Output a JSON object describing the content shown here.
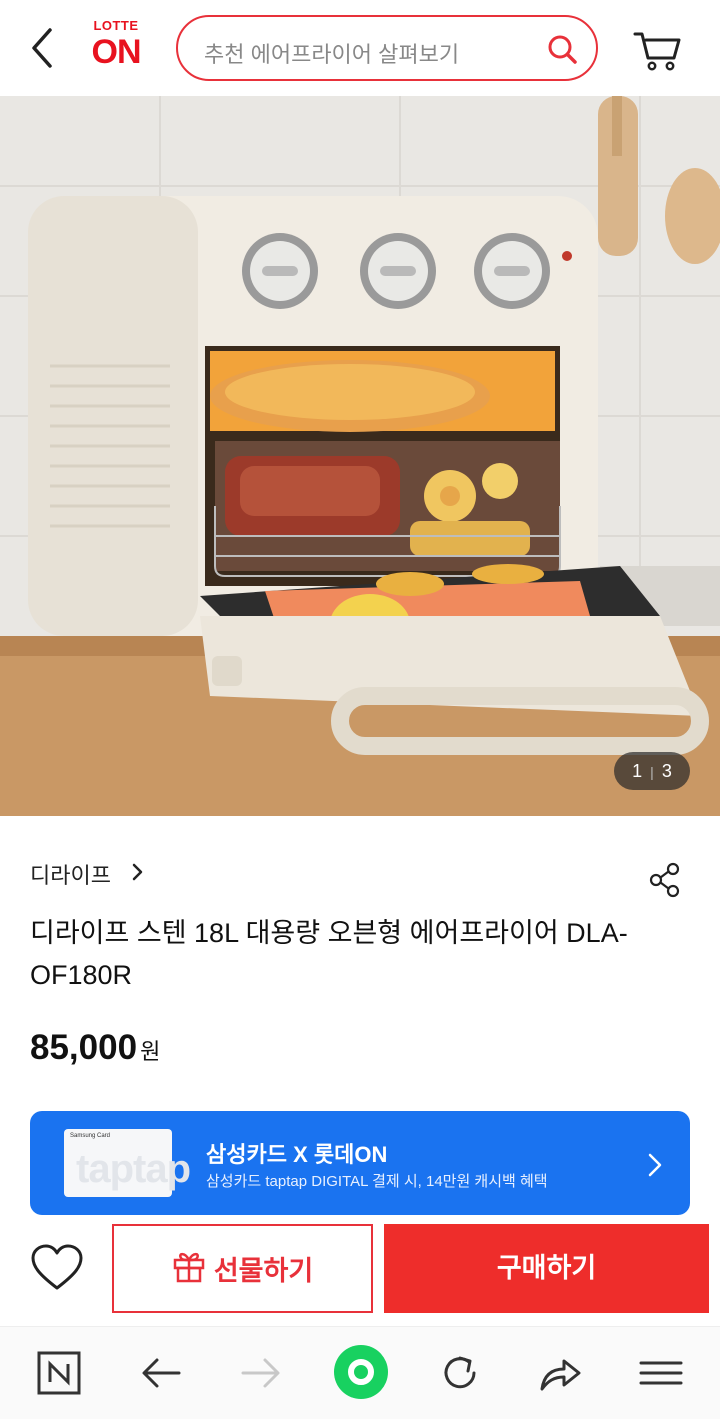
{
  "header": {
    "logo_top": "LOTTE",
    "logo_bottom": "ON",
    "search_placeholder": "추천 에어프라이어 살펴보기",
    "icons": [
      "back-chevron-icon",
      "search-icon",
      "cart-icon"
    ]
  },
  "gallery": {
    "current": "1",
    "total": "3"
  },
  "product": {
    "brand": "디라이프",
    "title": "디라이프 스텐 18L 대용량 오븐형 에어프라이어 DLA-OF180R",
    "price": "85,000",
    "price_unit": "원"
  },
  "banner": {
    "title": "삼성카드 X 롯데ON",
    "subtitle": "삼성카드 taptap DIGITAL 결제 시, 14만원 캐시백 혜택",
    "card_brand": "Samsung Card",
    "card_mark": "taptap",
    "color": "#1a73f0"
  },
  "actions": {
    "gift_label": "선물하기",
    "buy_label": "구매하기",
    "accent": "#ee2d2b"
  },
  "browser_bar": {
    "icons": [
      "naver-n-icon",
      "back-arrow-icon",
      "forward-arrow-icon",
      "home-green-circle-icon",
      "refresh-icon",
      "share-arrow-icon",
      "menu-icon"
    ]
  }
}
